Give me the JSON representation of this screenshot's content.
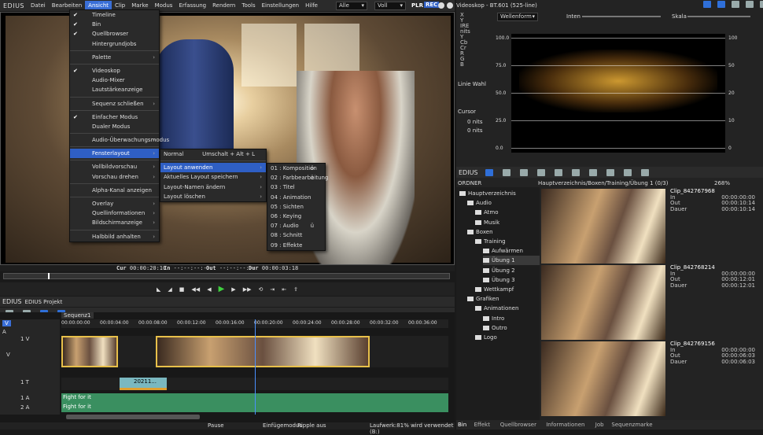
{
  "app": {
    "logo": "EDIUS"
  },
  "menubar": {
    "items": [
      "Datei",
      "Bearbeiten",
      "Ansicht",
      "Clip",
      "Marke",
      "Modus",
      "Erfassung",
      "Rendern",
      "Tools",
      "Einstellungen",
      "Hilfe"
    ],
    "active_index": 2
  },
  "player_top": {
    "select1": "Alle",
    "select2": "Voll",
    "plr": "PLR",
    "rec": "REC"
  },
  "view_menu": {
    "items": [
      {
        "label": "Timeline",
        "checked": true,
        "sub": false
      },
      {
        "label": "Bin",
        "checked": true,
        "sub": false
      },
      {
        "label": "Quellbrowser",
        "checked": true,
        "sub": false
      },
      {
        "label": "Hintergrundjobs",
        "checked": false,
        "sub": false
      },
      {
        "sep": true
      },
      {
        "label": "Palette",
        "checked": false,
        "sub": true
      },
      {
        "sep": true
      },
      {
        "label": "Videoskop",
        "checked": true,
        "sub": false
      },
      {
        "label": "Audio-Mixer",
        "checked": false,
        "sub": false
      },
      {
        "label": "Lautstärkeanzeige",
        "checked": false,
        "sub": false
      },
      {
        "sep": true
      },
      {
        "label": "Sequenz schließen",
        "checked": false,
        "sub": true
      },
      {
        "sep": true
      },
      {
        "label": "Einfacher Modus",
        "checked": true,
        "sub": false
      },
      {
        "label": "Dualer Modus",
        "checked": false,
        "sub": false
      },
      {
        "sep": true
      },
      {
        "label": "Audio-Überwachungsmodus",
        "checked": false,
        "sub": true
      },
      {
        "sep": true
      },
      {
        "label": "Fensterlayout",
        "checked": false,
        "sub": true,
        "hl": true
      },
      {
        "sep": true
      },
      {
        "label": "Vollbildvorschau",
        "checked": false,
        "sub": true
      },
      {
        "label": "Vorschau drehen",
        "checked": false,
        "sub": true
      },
      {
        "sep": true
      },
      {
        "label": "Alpha-Kanal anzeigen",
        "checked": false,
        "sub": false
      },
      {
        "sep": true
      },
      {
        "label": "Overlay",
        "checked": false,
        "sub": true
      },
      {
        "label": "Quellinformationen",
        "checked": false,
        "sub": true
      },
      {
        "label": "Bildschirmanzeige",
        "checked": false,
        "sub": true
      },
      {
        "sep": true
      },
      {
        "label": "Halbbild anhalten",
        "checked": false,
        "sub": true
      }
    ]
  },
  "layout_menu": {
    "items": [
      {
        "label": "Normal",
        "shortcut": "Umschalt + Alt + L",
        "sub": false
      },
      {
        "sep": true
      },
      {
        "label": "Layout anwenden",
        "shortcut": "",
        "sub": true,
        "hl": true
      },
      {
        "label": "Aktuelles Layout speichern",
        "shortcut": "",
        "sub": true
      },
      {
        "label": "Layout-Namen ändern",
        "shortcut": "",
        "sub": true
      },
      {
        "label": "Layout löschen",
        "shortcut": "",
        "sub": true
      }
    ]
  },
  "apply_menu": {
    "items": [
      {
        "label": "01 : Komposition",
        "shortcut": "ö"
      },
      {
        "label": "02 : Farbbearbeitung",
        "shortcut": "ä"
      },
      {
        "label": "03 : Titel",
        "shortcut": ""
      },
      {
        "label": "04 : Animation",
        "shortcut": ""
      },
      {
        "label": "05 : Sichten",
        "shortcut": ""
      },
      {
        "label": "06 : Keying",
        "shortcut": ""
      },
      {
        "label": "07 : Audio",
        "shortcut": "ü"
      },
      {
        "label": "08 : Schnitt",
        "shortcut": ""
      },
      {
        "label": "09 : Effekte",
        "shortcut": ""
      }
    ]
  },
  "timecode": {
    "cur_label": "Cur",
    "cur": "00:00:20:10",
    "in_label": "In",
    "in": "--:--:--:--",
    "out_label": "Out",
    "out": "--:--:--:--",
    "dur_label": "Dur",
    "dur": "00:00:03:18"
  },
  "project": {
    "logo": "EDIUS",
    "name": "EDIUS Projekt"
  },
  "timeline": {
    "sequence": "Sequenz1",
    "ruler": [
      "00:00:00:00",
      "00:00:04:00",
      "00:00:08:00",
      "00:00:12:00",
      "00:00:16:00",
      "00:00:20:00",
      "00:00:24:00",
      "00:00:28:00",
      "00:00:32:00",
      "00:00:36:00"
    ],
    "tracks": [
      "V",
      "A",
      "1 V",
      "V",
      "1 T",
      "1 A",
      "2 A"
    ],
    "title_clip": "20211...",
    "audio_clip_1": "Fight for it",
    "audio_clip_2": "Fight for it"
  },
  "status": {
    "pause": "Pause",
    "mode": "Einfügemodus",
    "ripple": "Ripple aus",
    "disk": "Laufwerk:81% wird verwendet (B:)"
  },
  "scope": {
    "title": "Videoskop - BT.601 (525-line)",
    "mode": "Wellenform",
    "inten": "Inten",
    "skala": "Skala",
    "side_labels": [
      "X",
      "Y",
      "IRE",
      "nits",
      "Y",
      "Cb",
      "Cr",
      "R",
      "G",
      "B"
    ],
    "linie_wahl": "Linie Wahl",
    "cursor": "Cursor",
    "cursor_val1": "0",
    "cursor_val2": "0",
    "unit": "nits",
    "left_axis": [
      "100.0",
      "75.0",
      "50.0",
      "25.0",
      "0.0"
    ],
    "right_axis": [
      "100",
      "50",
      "20",
      "10",
      "0"
    ]
  },
  "bin": {
    "logo": "EDIUS",
    "folder_header": "ORDNER",
    "path": "Hauptverzeichnis/Boxen/Training/Übung 1 (0/3)",
    "zoom": "268%",
    "tree": [
      {
        "label": "Hauptverzeichnis",
        "indent": 0
      },
      {
        "label": "Audio",
        "indent": 1
      },
      {
        "label": "Atmo",
        "indent": 2
      },
      {
        "label": "Musik",
        "indent": 2
      },
      {
        "label": "Boxen",
        "indent": 1
      },
      {
        "label": "Training",
        "indent": 2
      },
      {
        "label": "Aufwärmen",
        "indent": 3
      },
      {
        "label": "Übung 1",
        "indent": 3,
        "sel": true
      },
      {
        "label": "Übung 2",
        "indent": 3
      },
      {
        "label": "Übung 3",
        "indent": 3
      },
      {
        "label": "Wettkampf",
        "indent": 2
      },
      {
        "label": "Grafiken",
        "indent": 1
      },
      {
        "label": "Animationen",
        "indent": 2
      },
      {
        "label": "Intro",
        "indent": 3
      },
      {
        "label": "Outro",
        "indent": 3
      },
      {
        "label": "Logo",
        "indent": 2
      }
    ],
    "clips": [
      {
        "name": "Clip_842767968",
        "in": "00:00:00:00",
        "out": "00:00:10:14",
        "dur": "00:00:10:14"
      },
      {
        "name": "Clip_842768214",
        "in": "00:00:00:00",
        "out": "00:00:12:01",
        "dur": "00:00:12:01"
      },
      {
        "name": "Clip_842769156",
        "in": "00:00:00:00",
        "out": "00:00:06:03",
        "dur": "00:00:06:03"
      }
    ],
    "labels": {
      "in": "In",
      "out": "Out",
      "dur": "Dauer"
    },
    "tabs": [
      "Bin",
      "Effekt",
      "Quellbrowser",
      "Informationen",
      "Job",
      "Sequenzmarke"
    ]
  }
}
